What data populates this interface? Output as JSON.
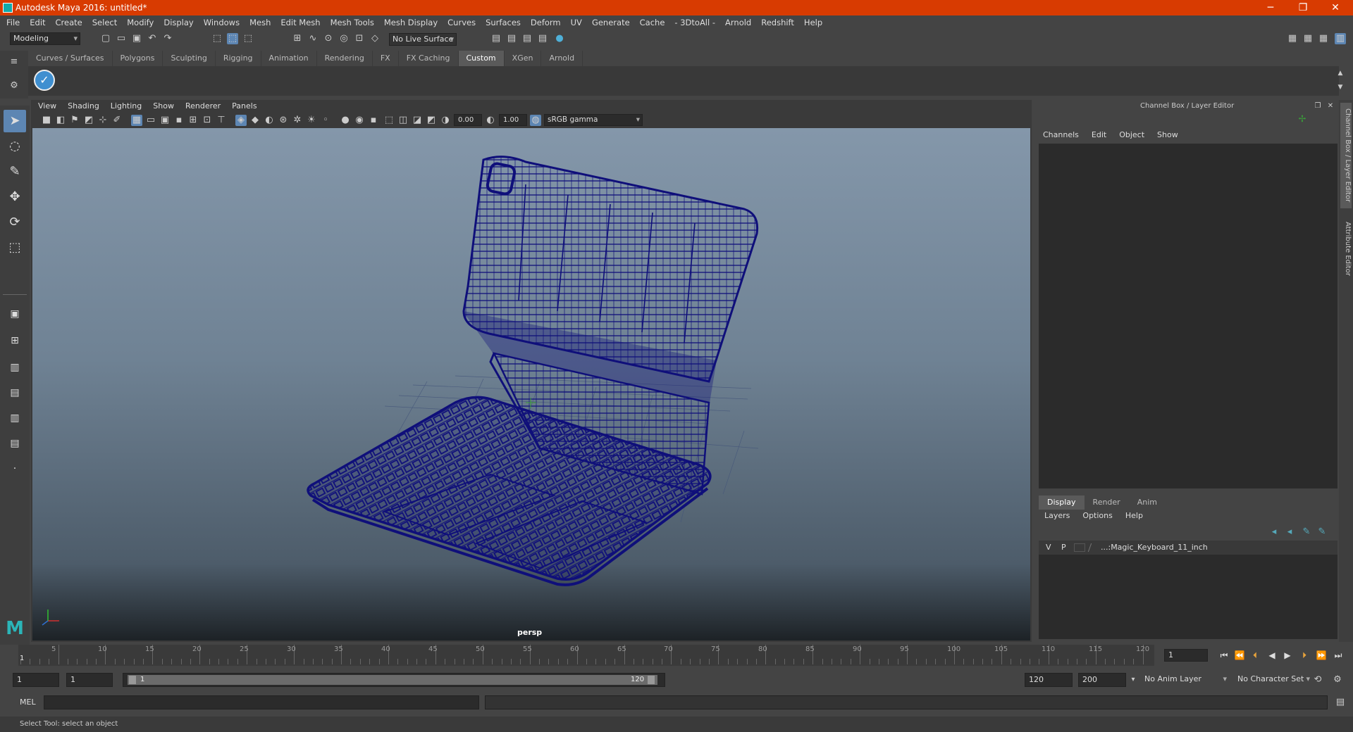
{
  "window": {
    "title": "Autodesk Maya 2016: untitled*",
    "minimize": "─",
    "restore": "❐",
    "close": "✕"
  },
  "menubar": [
    "File",
    "Edit",
    "Create",
    "Select",
    "Modify",
    "Display",
    "Windows",
    "Mesh",
    "Edit Mesh",
    "Mesh Tools",
    "Mesh Display",
    "Curves",
    "Surfaces",
    "Deform",
    "UV",
    "Generate",
    "Cache",
    "- 3DtoAll -",
    "Arnold",
    "Redshift",
    "Help"
  ],
  "statusline": {
    "mode": "Modeling",
    "live_surface": "No Live Surface"
  },
  "shelf": {
    "tabs": [
      "Curves / Surfaces",
      "Polygons",
      "Sculpting",
      "Rigging",
      "Animation",
      "Rendering",
      "FX",
      "FX Caching",
      "Custom",
      "XGen",
      "Arnold"
    ],
    "active": "Custom"
  },
  "panel": {
    "menus": [
      "View",
      "Shading",
      "Lighting",
      "Show",
      "Renderer",
      "Panels"
    ],
    "exposure": "0.00",
    "gamma": "1.00",
    "color_space": "sRGB gamma",
    "camera": "persp"
  },
  "right_panel": {
    "title": "Channel Box / Layer Editor",
    "channel_menus": [
      "Channels",
      "Edit",
      "Object",
      "Show"
    ],
    "layer_tabs": [
      "Display",
      "Render",
      "Anim"
    ],
    "active_layer_tab": "Display",
    "layer_menus": [
      "Layers",
      "Options",
      "Help"
    ],
    "layer": {
      "v": "V",
      "p": "P",
      "name": "...:Magic_Keyboard_11_inch"
    },
    "side_tabs": [
      "Channel Box / Layer Editor",
      "Attribute Editor"
    ]
  },
  "timeline": {
    "ticks": [
      "5",
      "10",
      "15",
      "20",
      "25",
      "30",
      "35",
      "40",
      "45",
      "50",
      "55",
      "60",
      "65",
      "70",
      "75",
      "80",
      "85",
      "90",
      "95",
      "100",
      "105",
      "110",
      "115",
      "120"
    ],
    "start_marker": "1",
    "current_frame": "1"
  },
  "range": {
    "start": "1",
    "playback_start": "1",
    "slider_start": "1",
    "slider_end": "120",
    "playback_end": "120",
    "end": "200",
    "anim_layer": "No Anim Layer",
    "character_set": "No Character Set"
  },
  "command": {
    "label": "MEL"
  },
  "help_line": "Select Tool: select an object",
  "colors": {
    "title_bar": "#d83b01",
    "wireframe": "#0f0f7a",
    "highlight": "#5d86b3"
  }
}
